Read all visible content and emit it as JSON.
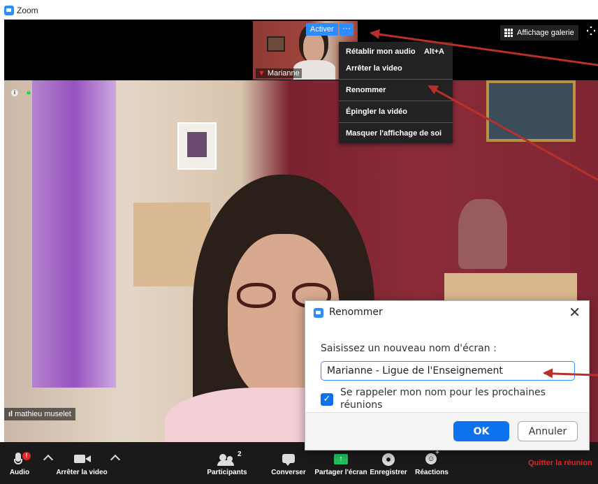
{
  "window": {
    "title": "Zoom"
  },
  "gallery_view_label": "Affichage galerie",
  "self_view": {
    "name": "Marianne",
    "activate_label": "Activer",
    "more_label": "···"
  },
  "context_menu": {
    "items": [
      {
        "label": "Rétablir mon audio",
        "shortcut": "Alt+A"
      },
      {
        "label": "Arrêter la video"
      },
      {
        "label": "Renommer"
      },
      {
        "label": "Épingler la vidéo"
      },
      {
        "label": "Masquer l'affichage de soi"
      }
    ]
  },
  "speaker": {
    "name": "mathieu muselet"
  },
  "toolbar": {
    "audio_label": "Audio",
    "audio_badge": "!",
    "video_label": "Arrêter la video",
    "participants_label": "Participants",
    "participants_count": "2",
    "chat_label": "Converser",
    "share_label": "Partager l'écran",
    "record_label": "Enregistrer",
    "reactions_label": "Réactions",
    "leave_label": "Quitter la réunion"
  },
  "rename_dialog": {
    "title": "Renommer",
    "prompt": "Saisissez un nouveau nom d'écran :",
    "input_value": "Marianne - Ligue de l'Enseignement",
    "remember_label": "Se rappeler mon nom pour les prochaines réunions",
    "remember_checked": true,
    "ok_label": "OK",
    "cancel_label": "Annuler"
  },
  "colors": {
    "accent": "#2d8cff",
    "primary_button": "#0e72ed",
    "leave": "#e02828",
    "annotation_arrow": "#b8302a"
  }
}
